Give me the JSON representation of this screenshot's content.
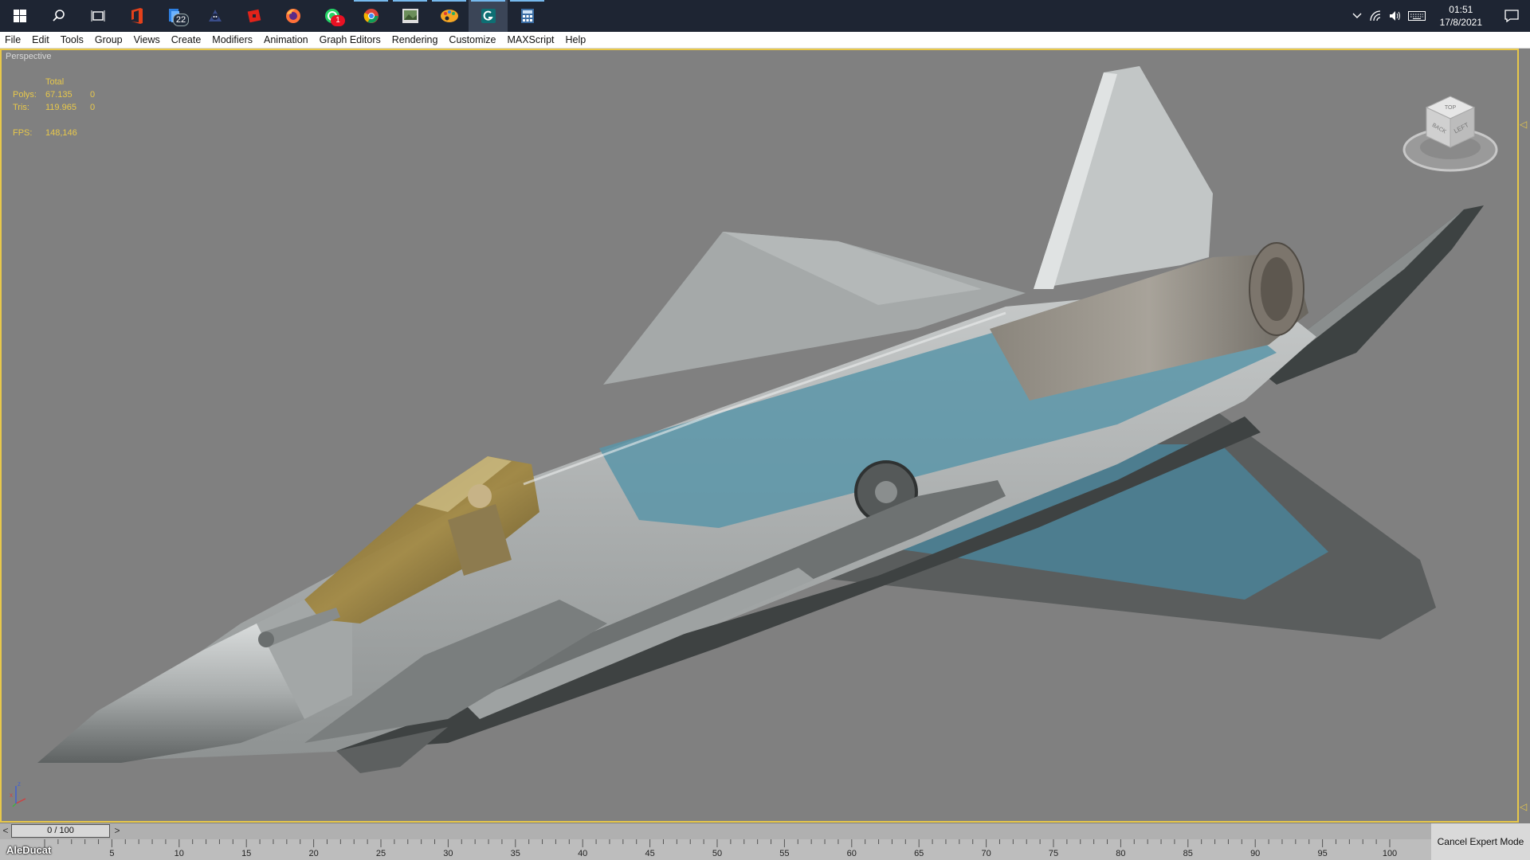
{
  "taskbar": {
    "apps": [
      {
        "name": "start-icon",
        "badge": ""
      },
      {
        "name": "search-icon",
        "badge": ""
      },
      {
        "name": "task-view-icon",
        "badge": ""
      },
      {
        "name": "office-icon",
        "badge": ""
      },
      {
        "name": "file-explorer-icon",
        "badge": "22"
      },
      {
        "name": "game-app-icon",
        "badge": ""
      },
      {
        "name": "roblox-icon",
        "badge": ""
      },
      {
        "name": "firefox-icon",
        "badge": ""
      },
      {
        "name": "whatsapp-icon",
        "badge": "1"
      },
      {
        "name": "chrome-icon",
        "badge": ""
      },
      {
        "name": "image-viewer-icon",
        "badge": ""
      },
      {
        "name": "paint-palette-icon",
        "badge": ""
      },
      {
        "name": "3ds-max-icon",
        "badge": ""
      },
      {
        "name": "calculator-icon",
        "badge": ""
      }
    ],
    "clock": {
      "time": "01:51",
      "date": "17/8/2021"
    }
  },
  "menubar": {
    "items": [
      "File",
      "Edit",
      "Tools",
      "Group",
      "Views",
      "Create",
      "Modifiers",
      "Animation",
      "Graph Editors",
      "Rendering",
      "Customize",
      "MAXScript",
      "Help"
    ]
  },
  "viewport": {
    "label": "Perspective",
    "stats": {
      "header": "Total",
      "polys_label": "Polys:",
      "polys_value": "67.135",
      "polys_sel": "0",
      "tris_label": "Tris:",
      "tris_value": "119.965",
      "tris_sel": "0",
      "fps_label": "FPS:",
      "fps_value": "148,146"
    },
    "viewcube": {
      "face_top": "TOP",
      "face_back": "BACK",
      "face_left": "LEFT"
    },
    "axis": {
      "x": "x",
      "y": "y",
      "z": "z"
    }
  },
  "timeline": {
    "prev": "<",
    "position": "0 / 100",
    "next": ">",
    "ticks": [
      "5",
      "10",
      "15",
      "20",
      "25",
      "30",
      "35",
      "40",
      "45",
      "50",
      "55",
      "60",
      "65",
      "70",
      "75",
      "80",
      "85",
      "90",
      "95",
      "100"
    ],
    "watermark": "AleDucat",
    "expert_button": "Cancel Expert Mode"
  },
  "colors": {
    "accent": "#e8c84a",
    "taskbar": "#1e2533",
    "viewport_bg": "#808080"
  }
}
